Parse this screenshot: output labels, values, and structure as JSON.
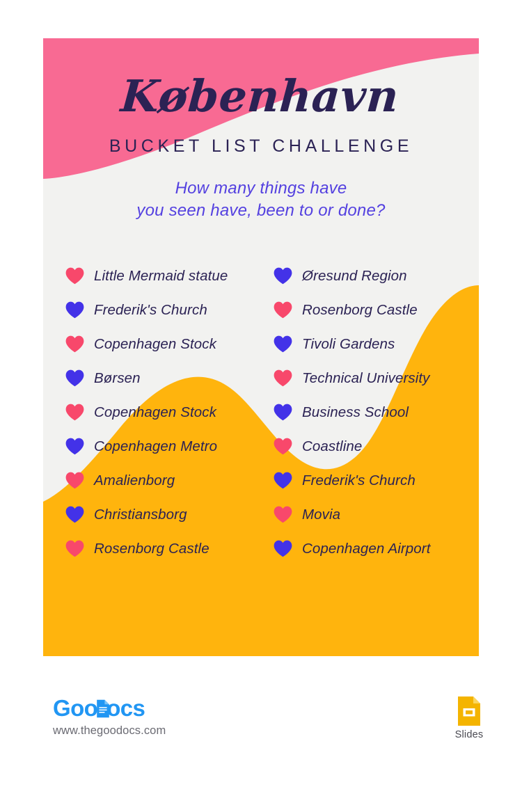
{
  "poster": {
    "title": "København",
    "subtitle": "BUCKET LIST CHALLENGE",
    "question": "How many things have\nyou seen have, been to or done?",
    "colors": {
      "card_background": "#f2f2f0",
      "top_wave_pink": "#f86a93",
      "bottom_wave_orange": "#ffb40d",
      "title_navy": "#2b2254",
      "question_purple": "#5441e0",
      "heart_pink": "#f8486b",
      "heart_blue": "#4332e8"
    },
    "checklist": {
      "left_column": [
        {
          "icon": "heart-icon",
          "color": "pink",
          "label": "Little Mermaid statue"
        },
        {
          "icon": "heart-icon",
          "color": "blue",
          "label": "Frederik's Church"
        },
        {
          "icon": "heart-icon",
          "color": "pink",
          "label": "Copenhagen Stock"
        },
        {
          "icon": "heart-icon",
          "color": "blue",
          "label": "Børsen"
        },
        {
          "icon": "heart-icon",
          "color": "pink",
          "label": "Copenhagen Stock"
        },
        {
          "icon": "heart-icon",
          "color": "blue",
          "label": "Copenhagen Metro"
        },
        {
          "icon": "heart-icon",
          "color": "pink",
          "label": "Amalienborg"
        },
        {
          "icon": "heart-icon",
          "color": "blue",
          "label": "Christiansborg"
        },
        {
          "icon": "heart-icon",
          "color": "pink",
          "label": "Rosenborg Castle"
        }
      ],
      "right_column": [
        {
          "icon": "heart-icon",
          "color": "blue",
          "label": "Øresund Region"
        },
        {
          "icon": "heart-icon",
          "color": "pink",
          "label": "Rosenborg Castle"
        },
        {
          "icon": "heart-icon",
          "color": "blue",
          "label": "Tivoli Gardens"
        },
        {
          "icon": "heart-icon",
          "color": "pink",
          "label": "Technical University"
        },
        {
          "icon": "heart-icon",
          "color": "blue",
          "label": "Business School"
        },
        {
          "icon": "heart-icon",
          "color": "pink",
          "label": "Coastline"
        },
        {
          "icon": "heart-icon",
          "color": "blue",
          "label": "Frederik's Church"
        },
        {
          "icon": "heart-icon",
          "color": "pink",
          "label": "Movia"
        },
        {
          "icon": "heart-icon",
          "color": "blue",
          "label": "Copenhagen Airport"
        }
      ]
    }
  },
  "footer": {
    "brand_part_1": "Goo",
    "brand_part_2": "ocs",
    "brand_icon": "document-icon",
    "url": "www.thegoodocs.com",
    "slides_label": "Slides",
    "slides_icon": "google-slides-icon",
    "brand_color": "#2196f3",
    "slides_color": "#f4b400"
  }
}
